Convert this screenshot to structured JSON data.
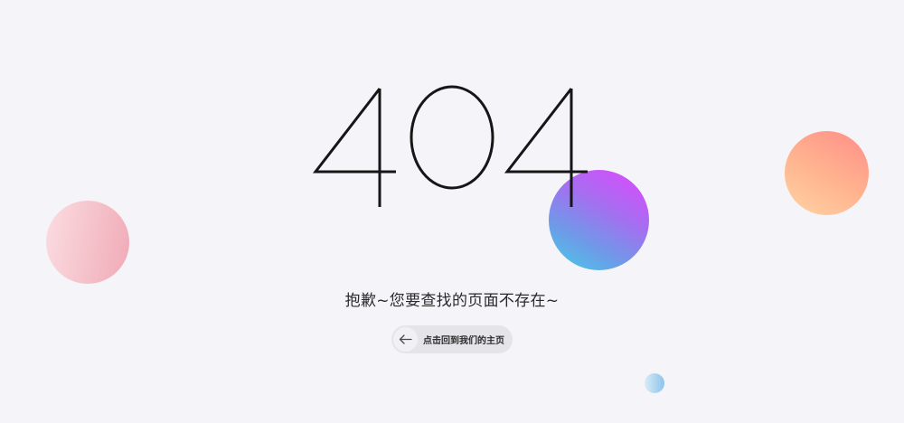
{
  "error": {
    "code": "404",
    "message": "抱歉~您要查找的页面不存在~"
  },
  "home_button": {
    "label": "点击回到我们的主页",
    "icon": "arrow-left-icon"
  },
  "colors": {
    "background": "#f5f4f8",
    "digits": "#161616",
    "button_bg": "#e5e4e9"
  }
}
